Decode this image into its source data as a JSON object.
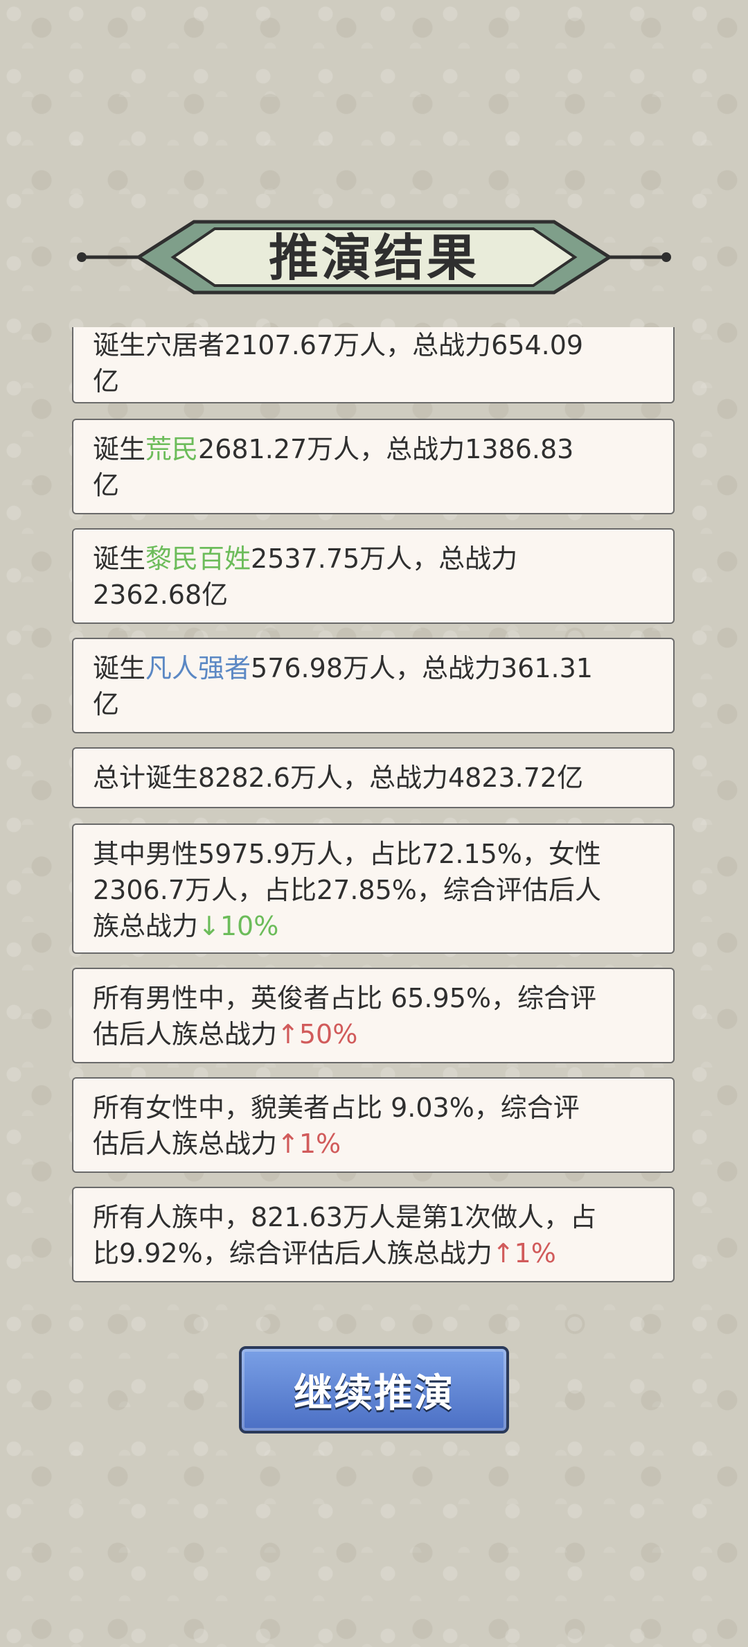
{
  "title": "推演结果",
  "cards": [
    {
      "line1_prefix": "诞生穴居者2107.67万人，总战力654.09",
      "line2": "亿"
    },
    {
      "line1_prefix": "诞生",
      "line1_highlight": "荒民",
      "line1_rest": "2681.27万人，总战力1386.83",
      "line2": "亿"
    },
    {
      "line1_prefix": "诞生",
      "line1_highlight": "黎民百姓",
      "line1_rest": "2537.75万人，总战力",
      "line2": "2362.68亿"
    },
    {
      "line1_prefix": "诞生",
      "line1_highlight": "凡人强者",
      "line1_rest": "576.98万人，总战力361.31",
      "line2": "亿"
    },
    {
      "line1": "总计诞生8282.6万人，总战力4823.72亿"
    },
    {
      "line1": "其中男性5975.9万人，占比72.15%，女性",
      "line2": "2306.7万人，占比27.85%，综合评估后人",
      "line3_prefix": "族总战力",
      "line3_highlight": "↓10%"
    },
    {
      "line1": "所有男性中，英俊者占比 65.95%，综合评",
      "line2_prefix": "估后人族总战力",
      "line2_highlight": "↑50%"
    },
    {
      "line1": "所有女性中，貌美者占比 9.03%，综合评",
      "line2_prefix": "估后人族总战力",
      "line2_highlight": "↑1%"
    },
    {
      "line1": "所有人族中，821.63万人是第1次做人，占",
      "line2_prefix": "比9.92%，综合评估后人族总战力",
      "line2_highlight": "↑1%"
    }
  ],
  "button": {
    "label": "继续推演"
  },
  "colors": {
    "green_highlight": "#6cbc5a",
    "blue_highlight": "#5b88c4",
    "red_highlight": "#d15b5b",
    "card_background": "#fbf6f1",
    "button_blue": "#5b7fd4"
  }
}
